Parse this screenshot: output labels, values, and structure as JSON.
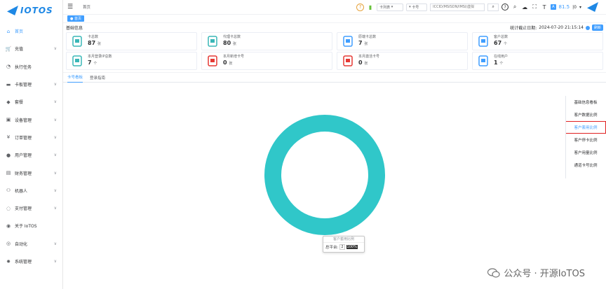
{
  "logo": {
    "text": "IOTOS"
  },
  "sidebar": {
    "items": [
      {
        "label": "首页",
        "icon": "home-icon",
        "glyph": "⌂",
        "active": true
      },
      {
        "label": "充值",
        "icon": "cart-icon",
        "glyph": "🛒",
        "chevron": true
      },
      {
        "label": "执行任务",
        "icon": "task-icon",
        "glyph": "◔",
        "chevron": false
      },
      {
        "label": "卡板管理",
        "icon": "card-icon",
        "glyph": "▬",
        "chevron": true
      },
      {
        "label": "套餐",
        "icon": "package-icon",
        "glyph": "◆",
        "chevron": true
      },
      {
        "label": "设备管理",
        "icon": "device-icon",
        "glyph": "▣",
        "chevron": true
      },
      {
        "label": "订单管理",
        "icon": "yen-icon",
        "glyph": "¥",
        "chevron": true
      },
      {
        "label": "用户管理",
        "icon": "user-icon",
        "glyph": "●",
        "chevron": true
      },
      {
        "label": "财务管理",
        "icon": "finance-icon",
        "glyph": "▤",
        "chevron": true
      },
      {
        "label": "机器人",
        "icon": "robot-icon",
        "glyph": "⚇",
        "chevron": true
      },
      {
        "label": "支付管理",
        "icon": "pay-icon",
        "glyph": "◌",
        "chevron": true
      },
      {
        "label": "关于 IoTOS",
        "icon": "about-icon",
        "glyph": "◉",
        "chevron": false
      },
      {
        "label": "自动化",
        "icon": "auto-icon",
        "glyph": "◎",
        "chevron": true
      },
      {
        "label": "系统管理",
        "icon": "settings-icon",
        "glyph": "✹",
        "chevron": true
      }
    ]
  },
  "topbar": {
    "breadcrumb": "首页",
    "select_type": "卡列表",
    "select_field": "卡号",
    "search_placeholder": "ICCID/MSISDN/IMSI/虚拟",
    "balance": "81.5",
    "separator": "|0",
    "font_label": "A"
  },
  "tagbar": {
    "tag": "● 首页"
  },
  "stats": {
    "title": "基础信息",
    "deadline_label": "统计截止日期:",
    "deadline": "2024-07-20 21:15:14",
    "refresh": "刷新",
    "cards": [
      {
        "label": "卡总数",
        "value": "87",
        "unit": "张",
        "icon": "sim-icon",
        "color": "#39b7b7"
      },
      {
        "label": "代理卡总数",
        "value": "80",
        "unit": "张",
        "icon": "agent-card-icon",
        "color": "#39b7b7"
      },
      {
        "label": "原端卡总数",
        "value": "7",
        "unit": "张",
        "icon": "source-card-icon",
        "color": "#409eff"
      },
      {
        "label": "客户总数",
        "value": "67",
        "unit": "个",
        "icon": "building-icon",
        "color": "#409eff"
      },
      {
        "label": "本月登录IP总数",
        "value": "7",
        "unit": "个",
        "icon": "ip-icon",
        "color": "#39b7b7"
      },
      {
        "label": "本月新增卡号",
        "value": "0",
        "unit": "张",
        "icon": "new-card-icon",
        "color": "#e53935"
      },
      {
        "label": "本月激活卡号",
        "value": "0",
        "unit": "张",
        "icon": "activate-card-icon",
        "color": "#e53935"
      },
      {
        "label": "在线用户",
        "value": "1",
        "unit": "个",
        "icon": "online-user-icon",
        "color": "#409eff"
      }
    ]
  },
  "main": {
    "tabs": [
      {
        "label": "卡号看板",
        "active": true
      },
      {
        "label": "登录指南",
        "active": false
      }
    ],
    "side_menu": [
      {
        "label": "基础信息看板",
        "active": false
      },
      {
        "label": "客户数据比例",
        "active": false
      },
      {
        "label": "客户套用比例",
        "active": true
      },
      {
        "label": "客户停卡比例",
        "active": false
      },
      {
        "label": "客户用量比例",
        "active": false
      },
      {
        "label": "通道卡号比例",
        "active": false
      }
    ]
  },
  "chart_data": {
    "type": "pie",
    "categories": [
      "总平台"
    ],
    "values": [
      2
    ],
    "colors": [
      "#30c7c9"
    ],
    "tooltip": {
      "title": "客户套用比例",
      "label": "总平台:",
      "count": "2",
      "percent": "100%"
    }
  },
  "watermark": {
    "text": "公众号 · 开源IoTOS"
  }
}
